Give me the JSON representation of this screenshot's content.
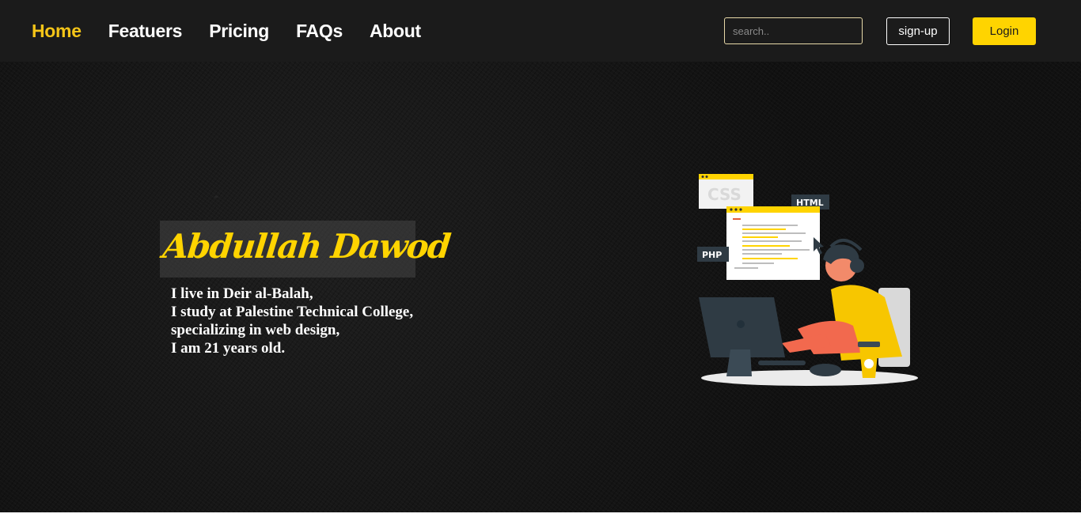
{
  "nav": {
    "links": [
      {
        "label": "Home",
        "active": true
      },
      {
        "label": "Featuers",
        "active": false
      },
      {
        "label": "Pricing",
        "active": false
      },
      {
        "label": "FAQs",
        "active": false
      },
      {
        "label": "About",
        "active": false
      }
    ],
    "search_placeholder": "search..",
    "signup_label": "sign-up",
    "login_label": "Login"
  },
  "hero": {
    "name": "Abdullah Dawod",
    "bio_lines": [
      "I live in Deir al-Balah,",
      "I study at Palestine Technical College,",
      "specializing in web design,",
      "I am 21 years old."
    ],
    "illustration_labels": {
      "css": "CSS",
      "html": "HTML",
      "php": "PHP"
    }
  },
  "colors": {
    "accent": "#ffd400",
    "navbar_bg": "#1b1b1b",
    "hero_bg": "#141414",
    "text": "#ffffff"
  },
  "icons": {
    "illustration": "web-developer-illustration"
  }
}
